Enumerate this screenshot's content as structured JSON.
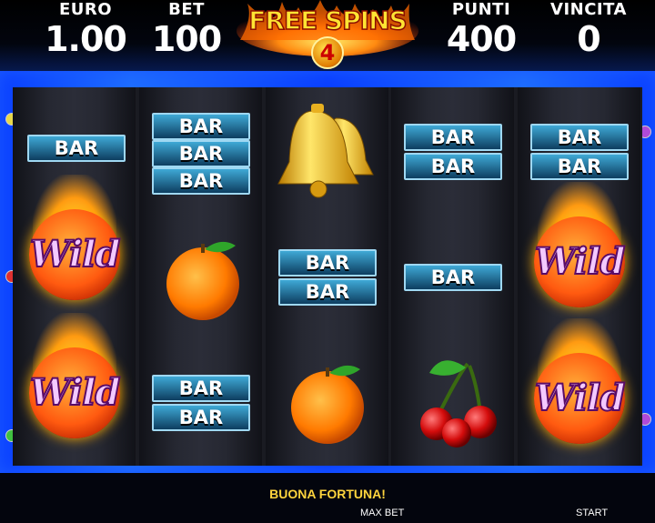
{
  "header": {
    "euro": {
      "label": "EURO",
      "value": "1.00"
    },
    "bet": {
      "label": "BET",
      "value": "100"
    },
    "free_spins": {
      "title": "FREE SPINS",
      "count": "4"
    },
    "punti": {
      "label": "PUNTI",
      "value": "400"
    },
    "vincita": {
      "label": "VINCITA",
      "value": "0"
    }
  },
  "reels": {
    "bar_label": "BAR",
    "wild_label": "Wild",
    "columns": [
      [
        "BAR",
        "Wild",
        "Wild"
      ],
      [
        "BAR BAR BAR",
        "orange",
        "BAR BAR"
      ],
      [
        "bell",
        "BAR BAR",
        "orange"
      ],
      [
        "BAR BAR",
        "BAR",
        "cherry"
      ],
      [
        "BAR BAR",
        "Wild",
        "Wild"
      ]
    ]
  },
  "status": {
    "message": "BUONA FORTUNA!",
    "max_bet": "MAX BET",
    "start": "START"
  },
  "colors": {
    "frame": "#1e6dff",
    "message": "#ffd43d",
    "bar": "#3fa9d6"
  }
}
